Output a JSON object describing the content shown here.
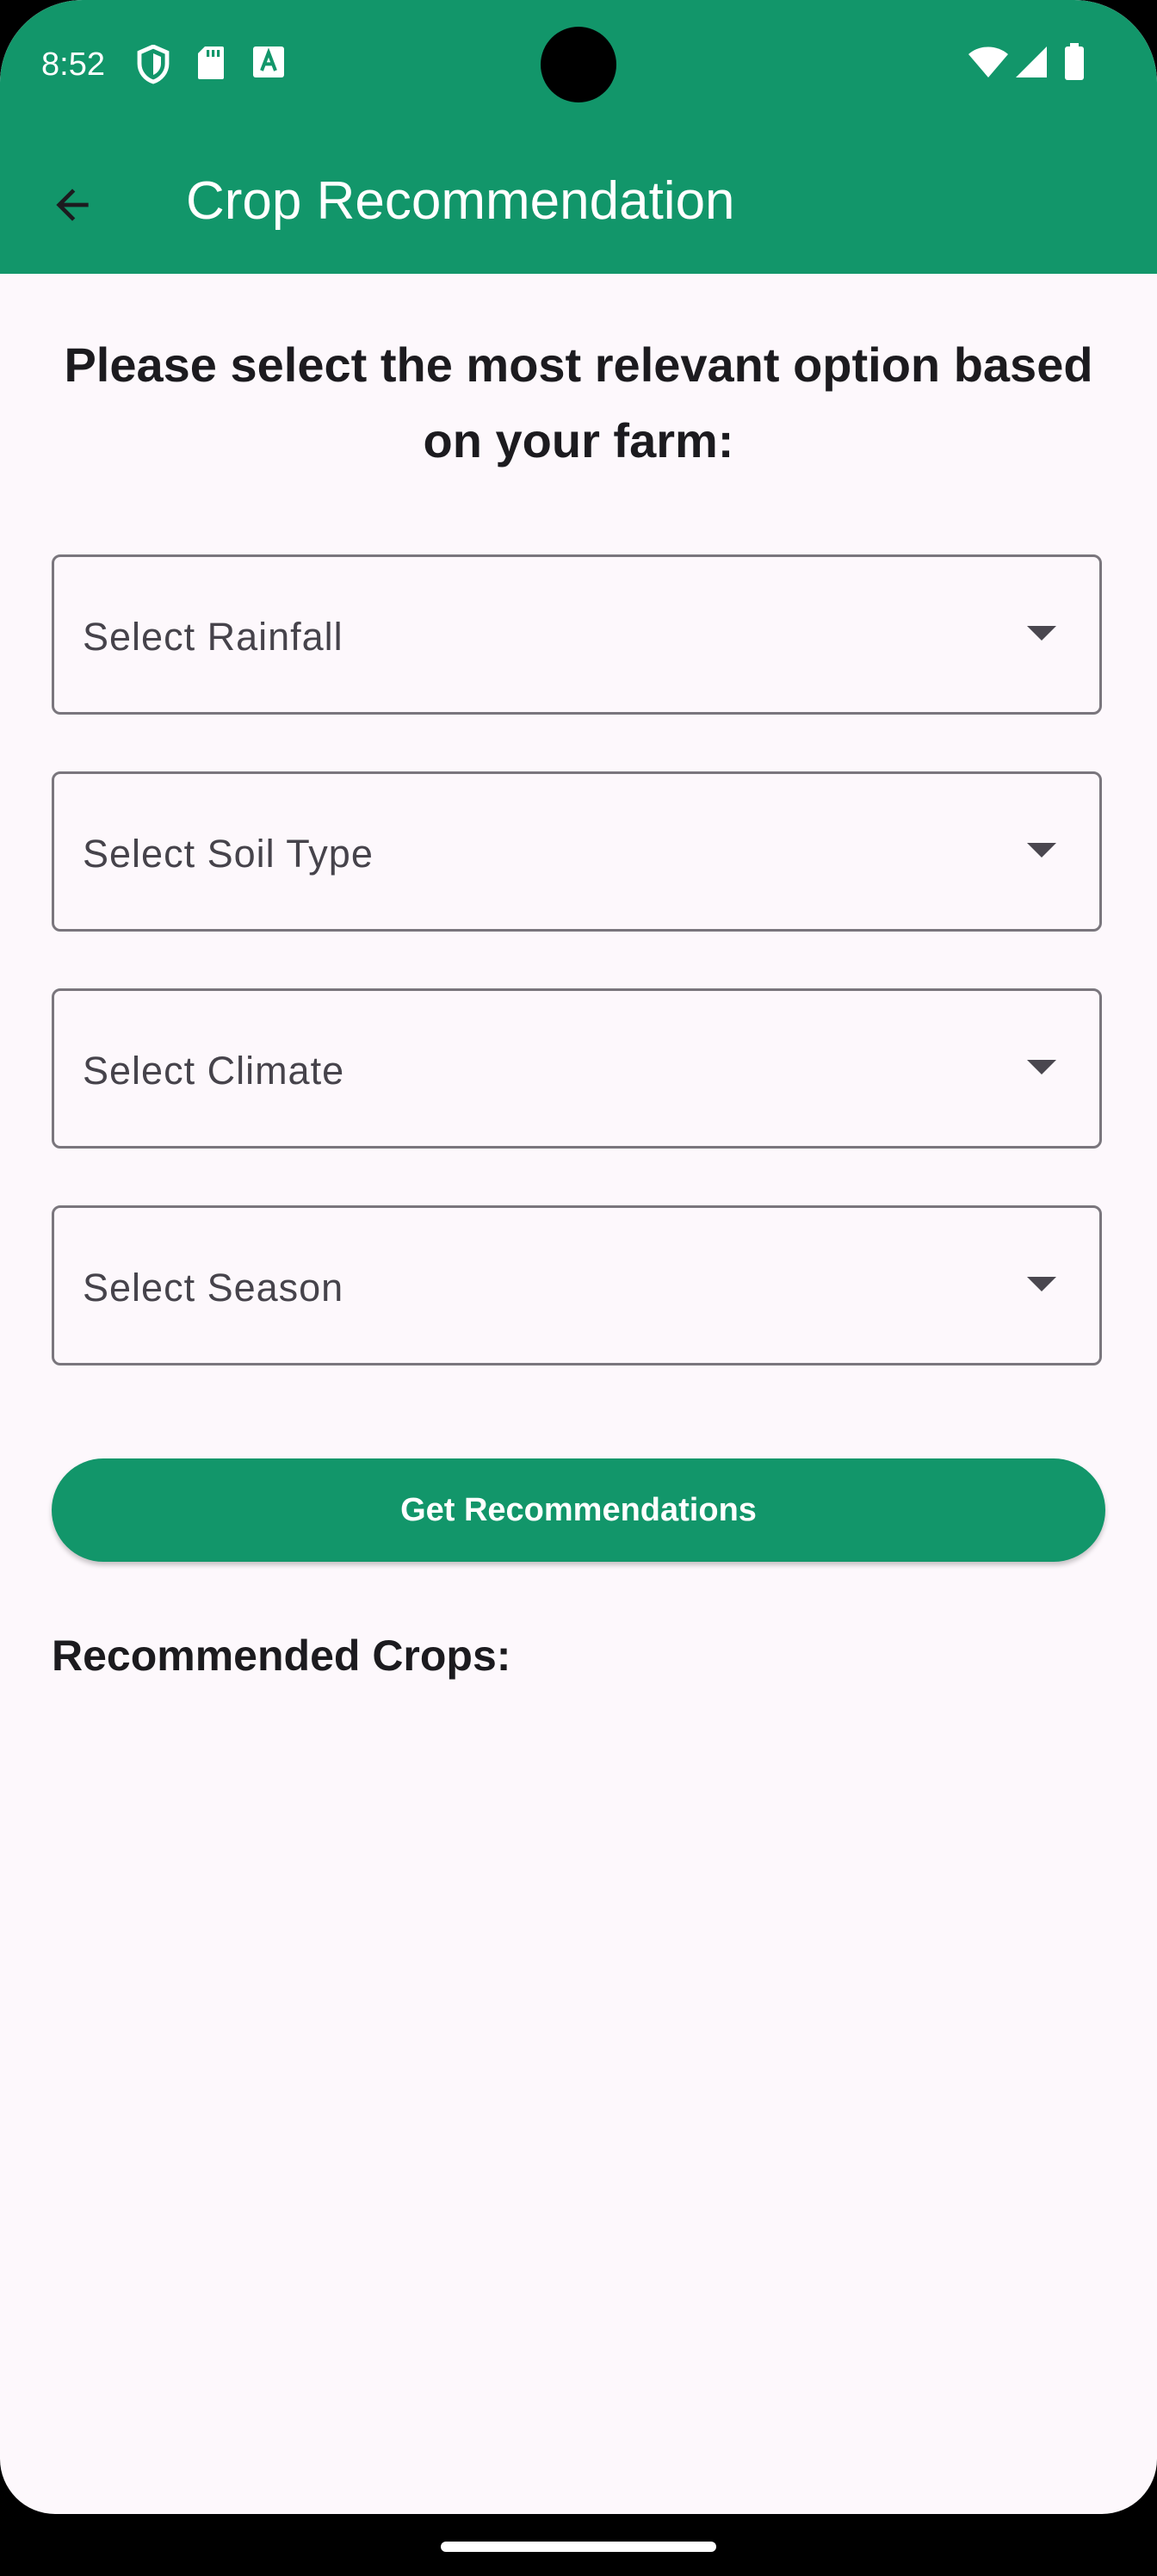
{
  "status_bar": {
    "time": "8:52",
    "icons_left": [
      "shield-icon",
      "sd-card-icon",
      "font-icon"
    ],
    "icons_right": [
      "wifi-icon",
      "cell-signal-icon",
      "battery-icon"
    ]
  },
  "app_bar": {
    "back_icon": "arrow-back-icon",
    "title": "Crop Recommendation",
    "color": "#12966a"
  },
  "main": {
    "heading": "Please select the most relevant option based on your farm:",
    "dropdowns": [
      {
        "label": "Select Rainfall"
      },
      {
        "label": "Select Soil Type"
      },
      {
        "label": "Select Climate"
      },
      {
        "label": "Select Season"
      }
    ],
    "button_label": "Get Recommendations",
    "results_title": "Recommended Crops:"
  }
}
